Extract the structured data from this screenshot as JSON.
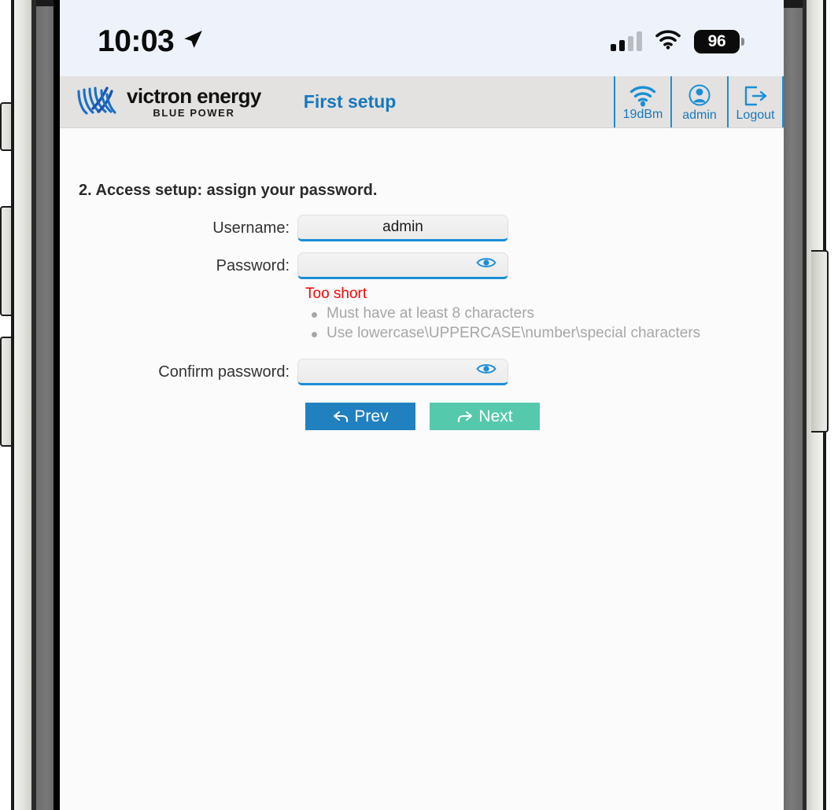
{
  "device": {
    "status_bar": {
      "time": "10:03",
      "location_icon": "location-arrow-icon",
      "cellular_icon": "cellular-signal-icon",
      "wifi_icon": "wifi-icon",
      "battery_level": "96"
    },
    "buttons": {
      "mute_switch": "mute-switch",
      "volume_up": "volume-up-button",
      "volume_down": "volume-down-button",
      "power": "power-button"
    }
  },
  "header": {
    "logo_main": "victron energy",
    "logo_sub": "BLUE POWER",
    "page_title": "First setup",
    "tools": [
      {
        "icon": "wifi-signal-icon",
        "label": "19dBm"
      },
      {
        "icon": "user-account-icon",
        "label": "admin"
      },
      {
        "icon": "logout-icon",
        "label": "Logout"
      }
    ]
  },
  "main": {
    "section_title": "2. Access setup: assign your password.",
    "fields": [
      {
        "label": "Username:",
        "value": "admin",
        "placeholder": "",
        "has_eye": false
      },
      {
        "label": "Password:",
        "value": "",
        "placeholder": "",
        "has_eye": true
      },
      {
        "label": "Confirm password:",
        "value": "",
        "placeholder": "",
        "has_eye": true
      }
    ],
    "validation": {
      "error": "Too short",
      "hints": [
        "Must have at least 8 characters",
        "Use lowercase\\UPPERCASE\\number\\special characters"
      ]
    },
    "buttons": {
      "prev": "Prev",
      "next": "Next"
    }
  },
  "colors": {
    "accent_blue": "#1b8ed6",
    "title_blue": "#1778be",
    "prev_button": "#2080c0",
    "next_button": "#55c9ab",
    "error_red": "#ff0000",
    "hint_gray": "#a7a7a7",
    "header_bg": "#e3e2e0",
    "statusbar_bg": "#eef2fa"
  }
}
